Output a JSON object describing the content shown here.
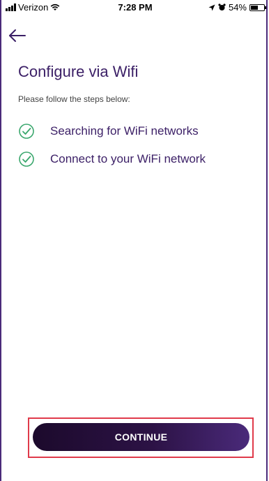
{
  "status_bar": {
    "carrier": "Verizon",
    "time": "7:28 PM",
    "battery_percent": "54%",
    "battery_level": 0.54
  },
  "icons": {
    "back": "arrow-left-icon",
    "check": "check-circle-icon",
    "wifi": "wifi-icon",
    "location": "location-arrow-icon",
    "alarm": "alarm-icon"
  },
  "page": {
    "title": "Configure via Wifi",
    "subtitle": "Please follow the steps below:"
  },
  "steps": [
    {
      "label": "Searching for WiFi networks",
      "done": true
    },
    {
      "label": "Connect to your WiFi network",
      "done": true
    }
  ],
  "actions": {
    "continue_label": "CONTINUE"
  },
  "colors": {
    "accent": "#3b1f66",
    "check": "#3aa76d",
    "highlight": "#e03a4a"
  }
}
